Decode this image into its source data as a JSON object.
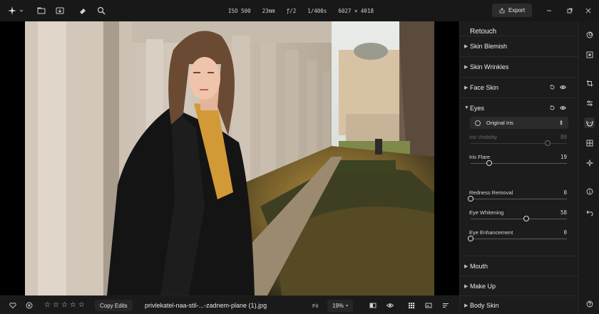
{
  "toolbar": {
    "icons": [
      "logo-star-icon",
      "chevron-down-icon",
      "folder-icon",
      "image-import-icon",
      "eraser-icon",
      "zoom-icon"
    ],
    "exif": {
      "iso": "ISO 500",
      "focal": "23mm",
      "aperture": "ƒ/2",
      "shutter": "1/400s",
      "dimensions": "6027 × 4018"
    },
    "export_label": "Export"
  },
  "window_controls": [
    "minimize-icon",
    "restore-icon",
    "close-icon"
  ],
  "panel": {
    "title": "Retouch",
    "sections": [
      {
        "label": "Skin Blemish",
        "expanded": false
      },
      {
        "label": "Skin Wrinkles",
        "expanded": false
      },
      {
        "label": "Face Skin",
        "expanded": false,
        "actions": true
      },
      {
        "label": "Eyes",
        "expanded": true,
        "actions": true
      },
      {
        "label": "Mouth",
        "expanded": false
      },
      {
        "label": "Make Up",
        "expanded": false
      },
      {
        "label": "Body Skin",
        "expanded": false
      }
    ],
    "iris_option": "Original Iris",
    "sliders": [
      {
        "label": "Iris Visibility",
        "value": "80",
        "fraction": 0.8,
        "disabled": true
      },
      {
        "label": "Iris Flare",
        "value": "19",
        "fraction": 0.19,
        "disabled": false
      },
      {
        "label": "Redness Removal",
        "value": "0",
        "fraction": 0.0,
        "disabled": false
      },
      {
        "label": "Eye Whitening",
        "value": "58",
        "fraction": 0.58,
        "disabled": false
      },
      {
        "label": "Eye Enhancement",
        "value": "0",
        "fraction": 0.0,
        "disabled": false
      }
    ]
  },
  "rail": {
    "icons": [
      "layers-icon",
      "select-icon",
      "crop-icon",
      "adjust-sliders-icon",
      "retouch-face-icon",
      "grid-icon",
      "magic-icon",
      "info-icon",
      "undo-icon",
      "help-icon"
    ],
    "active": "retouch-face-icon"
  },
  "bottombar": {
    "rating": 0,
    "copy_edits_label": "Copy Edits",
    "filename": "privlekatel-naa-stil-...-zadnem-plane (1).jpg",
    "fit_label": "Fit",
    "zoom_label": "19%"
  }
}
